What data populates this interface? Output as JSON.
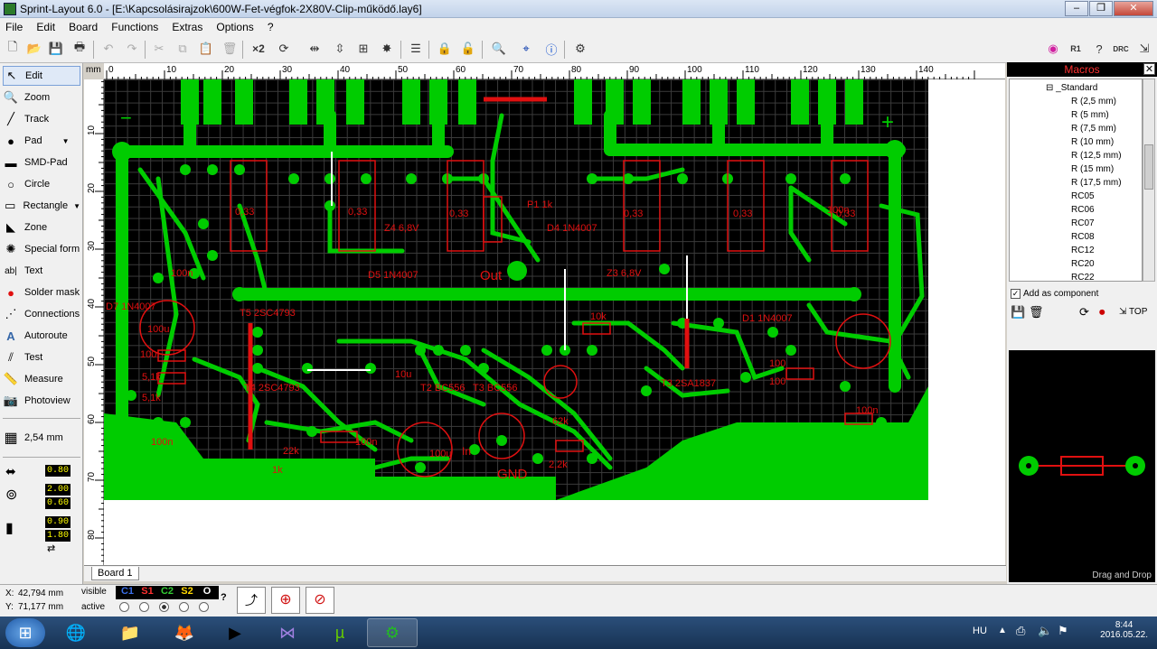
{
  "window": {
    "title": "Sprint-Layout 6.0 - [E:\\Kapcsolásirajzok\\600W-Fet-végfok-2X80V-Clip-működő.lay6]"
  },
  "menu": [
    "File",
    "Edit",
    "Board",
    "Functions",
    "Extras",
    "Options",
    "?"
  ],
  "toolbar": {
    "x2_label": "×2"
  },
  "tools": [
    {
      "label": "Edit",
      "icon": "pointer-icon"
    },
    {
      "label": "Zoom",
      "icon": "magnifier-icon"
    },
    {
      "label": "Track",
      "icon": "track-icon"
    },
    {
      "label": "Pad",
      "icon": "pad-icon"
    },
    {
      "label": "SMD-Pad",
      "icon": "smd-pad-icon"
    },
    {
      "label": "Circle",
      "icon": "circle-icon"
    },
    {
      "label": "Rectangle",
      "icon": "rectangle-icon"
    },
    {
      "label": "Zone",
      "icon": "zone-icon"
    },
    {
      "label": "Special form",
      "icon": "special-form-icon"
    },
    {
      "label": "Text",
      "icon": "text-icon"
    },
    {
      "label": "Solder mask",
      "icon": "solder-mask-icon"
    },
    {
      "label": "Connections",
      "icon": "connections-icon"
    },
    {
      "label": "Autoroute",
      "icon": "autoroute-icon"
    },
    {
      "label": "Test",
      "icon": "test-icon"
    },
    {
      "label": "Measure",
      "icon": "measure-icon"
    },
    {
      "label": "Photoview",
      "icon": "photoview-icon"
    }
  ],
  "grid": {
    "label": "2,54 mm"
  },
  "params": {
    "track_width": "0.80",
    "pad_outer": "2.00",
    "pad_inner": "0.60",
    "smd_w": "0.90",
    "smd_h": "1.80"
  },
  "ruler": {
    "unit": "mm",
    "top": [
      "0",
      "10",
      "20",
      "30",
      "40",
      "50",
      "60",
      "70",
      "80",
      "90",
      "100",
      "110",
      "120",
      "130",
      "140"
    ],
    "left": [
      "10",
      "20",
      "30",
      "40",
      "50",
      "60",
      "70",
      "80"
    ]
  },
  "board_tab": "Board 1",
  "status": {
    "x_label": "X:",
    "x_value": "42,794 mm",
    "y_label": "Y:",
    "y_value": "71,177 mm",
    "visible_label": "visible",
    "active_label": "active",
    "layers": [
      {
        "name": "C1",
        "color": "#3a6ee8"
      },
      {
        "name": "S1",
        "color": "#ff3030"
      },
      {
        "name": "C2",
        "color": "#33cc33"
      },
      {
        "name": "S2",
        "color": "#ffd800"
      },
      {
        "name": "O",
        "color": "#ffffff"
      }
    ]
  },
  "macros": {
    "header": "Macros",
    "root": "_Standard",
    "items": [
      "R (2,5 mm)",
      "R (5 mm)",
      "R (7,5 mm)",
      "R (10 mm)",
      "R (12,5 mm)",
      "R (15 mm)",
      "R (17,5 mm)",
      "RC05",
      "RC06",
      "RC07",
      "RC08",
      "RC12",
      "RC20",
      "RC22"
    ],
    "add_component": "Add as component",
    "top_label": "TOP",
    "drag_drop": "Drag and Drop"
  },
  "pcb_labels": {
    "out": "Out",
    "gnd": "GND",
    "in": "In",
    "r1": "0,33",
    "z4": "Z4 6,8V",
    "z3": "Z3 6,8V",
    "d4": "D4 1N4007",
    "d5": "D5 1N4007",
    "d1": "D1 1N4007",
    "d7": "D7 1N4007",
    "t5": "T5 2SC4793",
    "t4": "T4 2SC4793",
    "t3": "T3 2SA1837",
    "t2": "T2 BC556",
    "t3b": "T3 BC556",
    "r100": "100",
    "r51": "5,1k",
    "r1k": "1k",
    "p1": "P1 1k",
    "r62k": "62k",
    "r22k": "2,2k",
    "c100u": "100u",
    "c100n": "100n",
    "r10u": "10u",
    "r27k": "27k",
    "minus": "−",
    "plus": "+",
    "r10": "10",
    "r100n": "100n",
    "r22": "22k",
    "r10k": "10k",
    "r18k": "18k"
  },
  "taskbar": {
    "lang": "HU",
    "time": "8:44",
    "date": "2016.05.22."
  }
}
